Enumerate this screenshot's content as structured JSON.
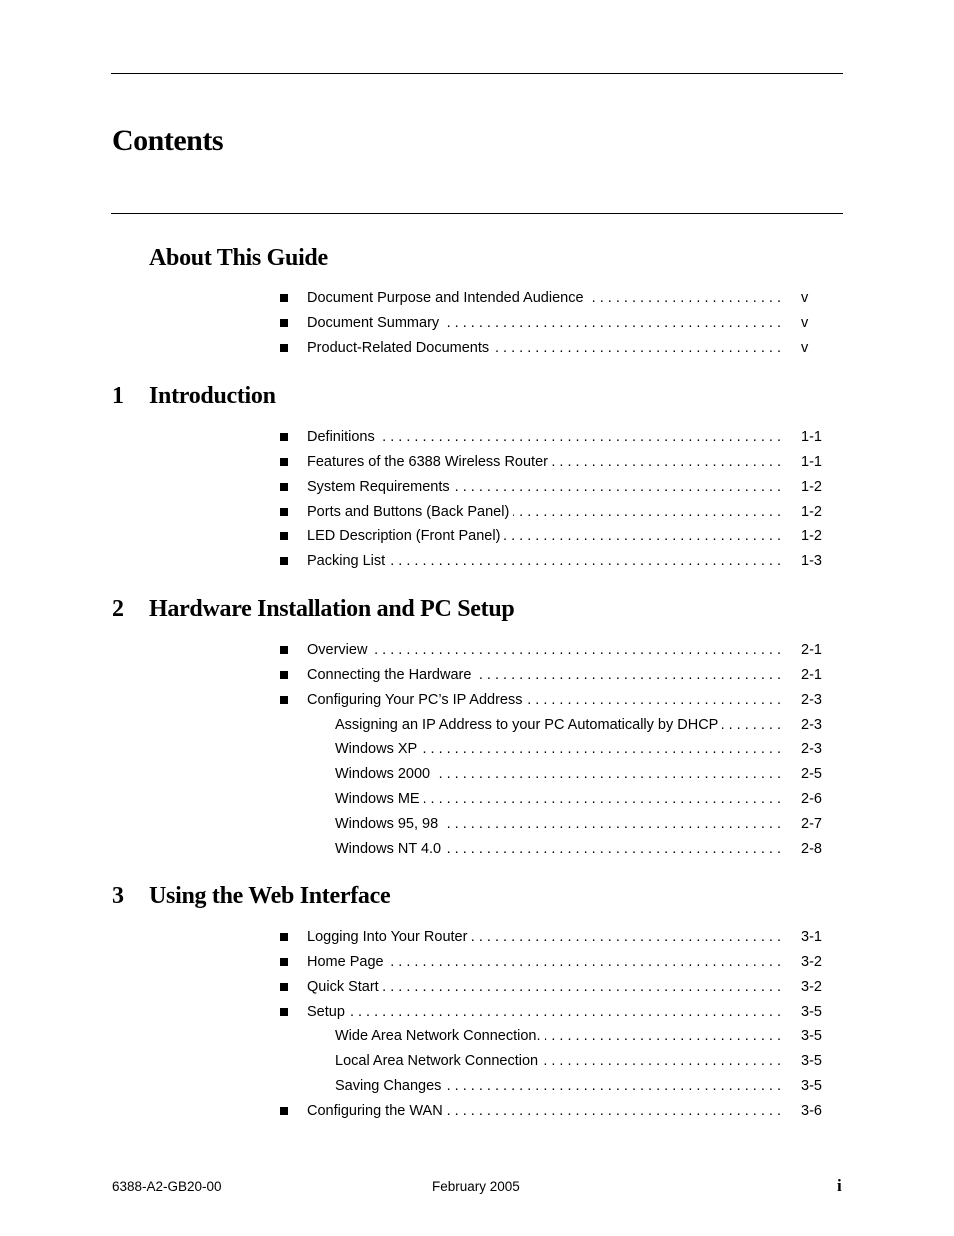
{
  "page_title": "Contents",
  "sections": [
    {
      "id": "about",
      "number": "",
      "title": "About This Guide",
      "entries": [
        {
          "level": 1,
          "label": "Document Purpose and Intended Audience",
          "page": "v"
        },
        {
          "level": 1,
          "label": "Document Summary",
          "page": "v"
        },
        {
          "level": 1,
          "label": "Product-Related Documents",
          "page": "v"
        }
      ]
    },
    {
      "id": "introduction",
      "number": "1",
      "title": "Introduction",
      "entries": [
        {
          "level": 1,
          "label": "Definitions",
          "page": "1-1"
        },
        {
          "level": 1,
          "label": "Features of the 6388 Wireless Router",
          "page": "1-1"
        },
        {
          "level": 1,
          "label": "System Requirements",
          "page": "1-2"
        },
        {
          "level": 1,
          "label": "Ports and Buttons (Back Panel)",
          "page": "1-2"
        },
        {
          "level": 1,
          "label": "LED Description (Front Panel)",
          "page": "1-2"
        },
        {
          "level": 1,
          "label": "Packing List",
          "page": "1-3"
        }
      ]
    },
    {
      "id": "hardware",
      "number": "2",
      "title": "Hardware Installation and PC Setup",
      "entries": [
        {
          "level": 1,
          "label": "Overview",
          "page": "2-1"
        },
        {
          "level": 1,
          "label": "Connecting the Hardware",
          "page": "2-1"
        },
        {
          "level": 1,
          "label": "Configuring Your PC’s IP Address",
          "page": "2-3"
        },
        {
          "level": 2,
          "label": "Assigning an IP Address to your PC Automatically by DHCP",
          "page": "2-3"
        },
        {
          "level": 2,
          "label": "Windows XP",
          "page": "2-3"
        },
        {
          "level": 2,
          "label": "Windows 2000",
          "page": "2-5"
        },
        {
          "level": 2,
          "label": "Windows ME",
          "page": "2-6"
        },
        {
          "level": 2,
          "label": "Windows 95, 98",
          "page": "2-7"
        },
        {
          "level": 2,
          "label": "Windows NT 4.0",
          "page": "2-8"
        }
      ]
    },
    {
      "id": "web-interface",
      "number": "3",
      "title": "Using the Web Interface",
      "entries": [
        {
          "level": 1,
          "label": "Logging Into Your Router",
          "page": "3-1"
        },
        {
          "level": 1,
          "label": "Home Page",
          "page": "3-2"
        },
        {
          "level": 1,
          "label": "Quick Start",
          "page": "3-2"
        },
        {
          "level": 1,
          "label": "Setup",
          "page": "3-5"
        },
        {
          "level": 2,
          "label": "Wide Area Network Connection.",
          "page": "3-5"
        },
        {
          "level": 2,
          "label": "Local Area Network Connection",
          "page": "3-5"
        },
        {
          "level": 2,
          "label": "Saving Changes",
          "page": "3-5"
        },
        {
          "level": 1,
          "label": "Configuring the WAN",
          "page": "3-6"
        }
      ]
    }
  ],
  "footer": {
    "document_number": "6388-A2-GB20-00",
    "date": "February 2005",
    "page_number": "i"
  }
}
